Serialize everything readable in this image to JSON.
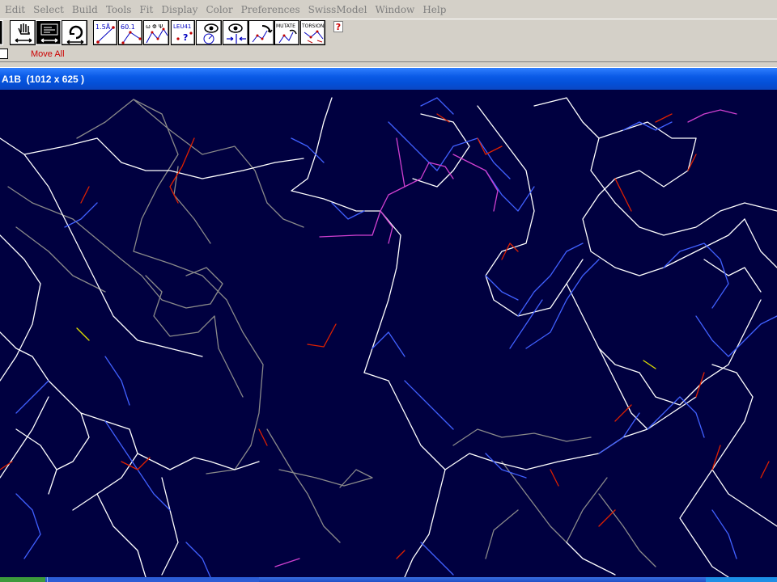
{
  "menu": {
    "items": [
      "Edit",
      "Select",
      "Build",
      "Tools",
      "Fit",
      "Display",
      "Color",
      "Preferences",
      "SwissModel",
      "Window",
      "Help"
    ]
  },
  "toolbar": {
    "measure_distance_label": "1.5Å",
    "measure_angle_label": "60.1",
    "measure_torsion_label": "ω Φ Ψ",
    "identify_label": "LEU41",
    "identify_q": "?",
    "mutate_label": "MUTATE",
    "torsion_label": "TORSION",
    "help_label": "?"
  },
  "status": {
    "mode_text": "Move All"
  },
  "window": {
    "title": "A1B  (1012 x 625 )"
  },
  "colors": {
    "viewport_bg": "#000040",
    "bond_white": "#ffffff",
    "bond_blue": "#4060ff",
    "bond_red": "#e02000",
    "bond_gray": "#8a8a8a",
    "bond_magenta": "#d040d0",
    "bond_yellow": "#e0e000",
    "titlebar_blue": "#0a5ae6",
    "menu_text_disabled": "#808080",
    "status_text": "#cc0000"
  },
  "icons": [
    "hand-icon",
    "move-arrows-icon",
    "rotate-icon",
    "distance-icon",
    "angle-icon",
    "torsion-icon",
    "identify-icon",
    "eye-center-icon",
    "eye-fit-icon",
    "molecule-move-icon",
    "mutate-icon",
    "torsion-tool-icon",
    "help-icon",
    "document-icon"
  ]
}
